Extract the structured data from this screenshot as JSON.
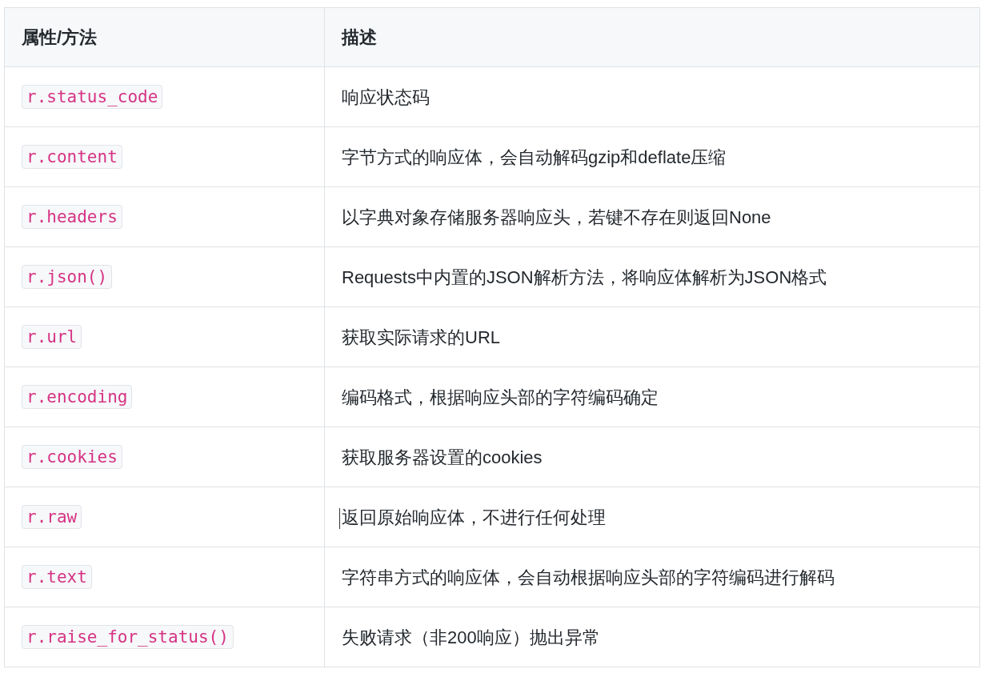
{
  "table": {
    "columns": [
      "属性/方法",
      "描述"
    ],
    "rows": [
      {
        "member": "r.status_code",
        "description": "响应状态码",
        "caret": false
      },
      {
        "member": "r.content",
        "description": "字节方式的响应体，会自动解码gzip和deflate压缩",
        "caret": false
      },
      {
        "member": "r.headers",
        "description": "以字典对象存储服务器响应头，若键不存在则返回None",
        "caret": false
      },
      {
        "member": "r.json()",
        "description": "Requests中内置的JSON解析方法，将响应体解析为JSON格式",
        "caret": false
      },
      {
        "member": "r.url",
        "description": "获取实际请求的URL",
        "caret": false
      },
      {
        "member": "r.encoding",
        "description": "编码格式，根据响应头部的字符编码确定",
        "caret": false
      },
      {
        "member": "r.cookies",
        "description": "获取服务器设置的cookies",
        "caret": false
      },
      {
        "member": "r.raw",
        "description": "返回原始响应体，不进行任何处理",
        "caret": true
      },
      {
        "member": "r.text",
        "description": "字符串方式的响应体，会自动根据响应头部的字符编码进行解码",
        "caret": false
      },
      {
        "member": "r.raise_for_status()",
        "description": "失败请求（非200响应）抛出异常",
        "caret": false
      }
    ]
  }
}
